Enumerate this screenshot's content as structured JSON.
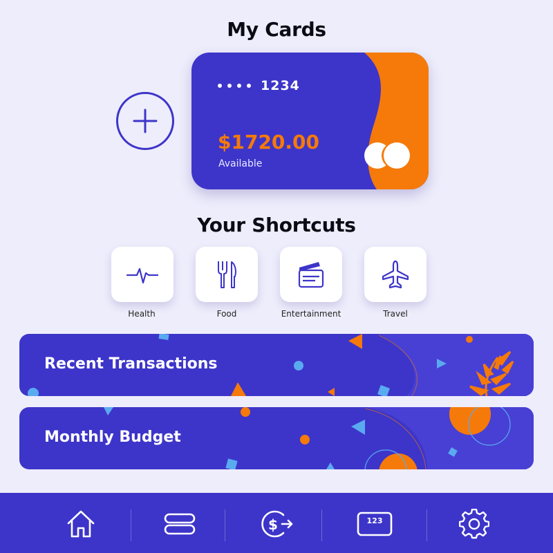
{
  "cards_section": {
    "title": "My Cards"
  },
  "card": {
    "last_digits": "1234",
    "balance": "$1720.00",
    "available_label": "Available"
  },
  "shortcuts_section": {
    "title": "Your Shortcuts",
    "items": [
      {
        "label": "Health",
        "icon": "heartbeat-icon"
      },
      {
        "label": "Food",
        "icon": "fork-knife-icon"
      },
      {
        "label": "Entertainment",
        "icon": "clapperboard-icon"
      },
      {
        "label": "Travel",
        "icon": "airplane-icon"
      }
    ]
  },
  "banners": [
    {
      "label": "Recent Transactions"
    },
    {
      "label": "Monthly Budget"
    }
  ],
  "bottom_nav": {
    "items": [
      "home-icon",
      "cards-icon",
      "transfer-icon",
      "card-number-icon",
      "gear-icon"
    ],
    "card_number_glyph": "123"
  },
  "colors": {
    "primary": "#3d35c9",
    "accent": "#f57a0a",
    "background": "#eeedfb",
    "light_blue": "#5aaaf0"
  }
}
